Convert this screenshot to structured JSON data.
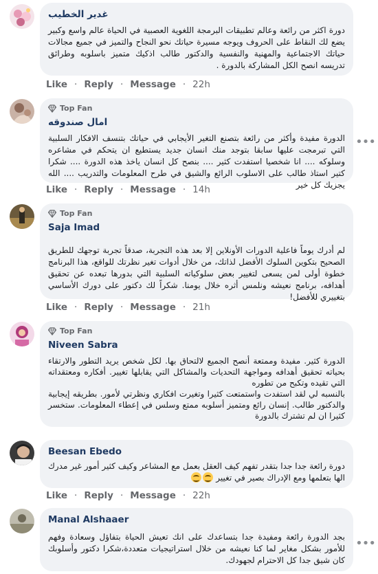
{
  "action_labels": {
    "like": "Like",
    "reply": "Reply",
    "message": "Message",
    "separator": "·"
  },
  "top_fan_label": "Top Fan",
  "comments": [
    {
      "author": "غدير الخطيب",
      "text": "دورة اكثر من رائعة وعالم تطبيقات البرمجة اللغوية العصبية في الحياة عالم واسع وكبير يضع لك النقاط على الحروف ويوجه مسيرة حياتك نحو النجاح والتميز في جميع مجالات حياتك الاجتماعية والمهنية والنفسية والدكتور طالب اذكيك متميز باسلوبه وطرائق تدريسه انصح الكل المشاركة بالدورة .",
      "time": "22h"
    },
    {
      "author": "امال صندوقه",
      "badge": true,
      "text": "الدورة مفيدة وأكثر من رائعة بتصنع التغير الأيجابي في حياتك بتنسف الافكار السلبية التي تبرمجت عليها سابقا بتوجد منك انسان جديد يستطيع ان يتحكم في مشاعره وسلوكه .... انا شخصيا استفدت كثير .... بنصح كل انسان ياخذ هذه الدورة .... شكرا كتير استاذ طالب على الاسلوب الرائع والشيق في طرح المعلومات والتدريب .... الله يجزيك كل خير",
      "time": "14h"
    },
    {
      "author": "Saja Imad",
      "badge": true,
      "text": "لم أدرك يوماً فاعلية الدورات الأونلاين إلا بعد هذه التجربة، صدقاً تجربة توجهك للطريق الصحيح بتكوين السلوك الأفضل لذاتك، من خلال أدوات تغير نظرتك للواقع، هذا البرنامج خطوة أولى لمن يسعى لتغيير بعض سلوكياته السلبية التي بدورها تبعده عن تحقيق أهدافه، برنامج نعيشه ونلمس أثره خلال يومنا. شكراً لك دكتور على دورك الأساسي بتغييري للأفضل!",
      "time": "21h"
    },
    {
      "author": "Niveen Sabra",
      "badge": true,
      "text1": "الدورة كثير. مفيدة وممتعة أنصح الجميع لالتحاق بها. لكل شخص يريد التطور والارتقاء بحياته تحقيق أهدافه ومواجهة التحديات والمشاكل التي يقابلها تغيير. أفكاره ومعتقداته التي تقيده وتكبح من تطوره",
      "text2": "بالنسبه لي لقد استفدت واستمتعت كثيرا وتغيرت افكاري ونظرتي لأمور. بطريقه إيجابية والدكتور طالب. إنسان رائع ومتميز أسلوبه ممتع وسلس في إعطاء المعلومات. ستخسر كثيرا ان لم تشترك بالدورة"
    },
    {
      "author": "Beesan Ebedo",
      "text": "دورة رائعة جدا جدا بتقدر تفهم كيف العقل بعمل مع المشاعر وكيف كثير أمور غير مدرك الها بتعلمها ومع الإدراك بصير في تغيير",
      "time": "22h"
    },
    {
      "author": "Manal Alshaaer",
      "text": "بجد الدورة رائعة ومفيدة جدا بتساعدك على انك تعيش الحياة بتفاؤل وسعادة وفهم للأمور بشكل مغاير لما كنا نعيشه من خلال استراتيجيات متعددة،شكرا دكتور وأسلوبك كان شيق جدا كل الاحترام لجهودك."
    }
  ]
}
